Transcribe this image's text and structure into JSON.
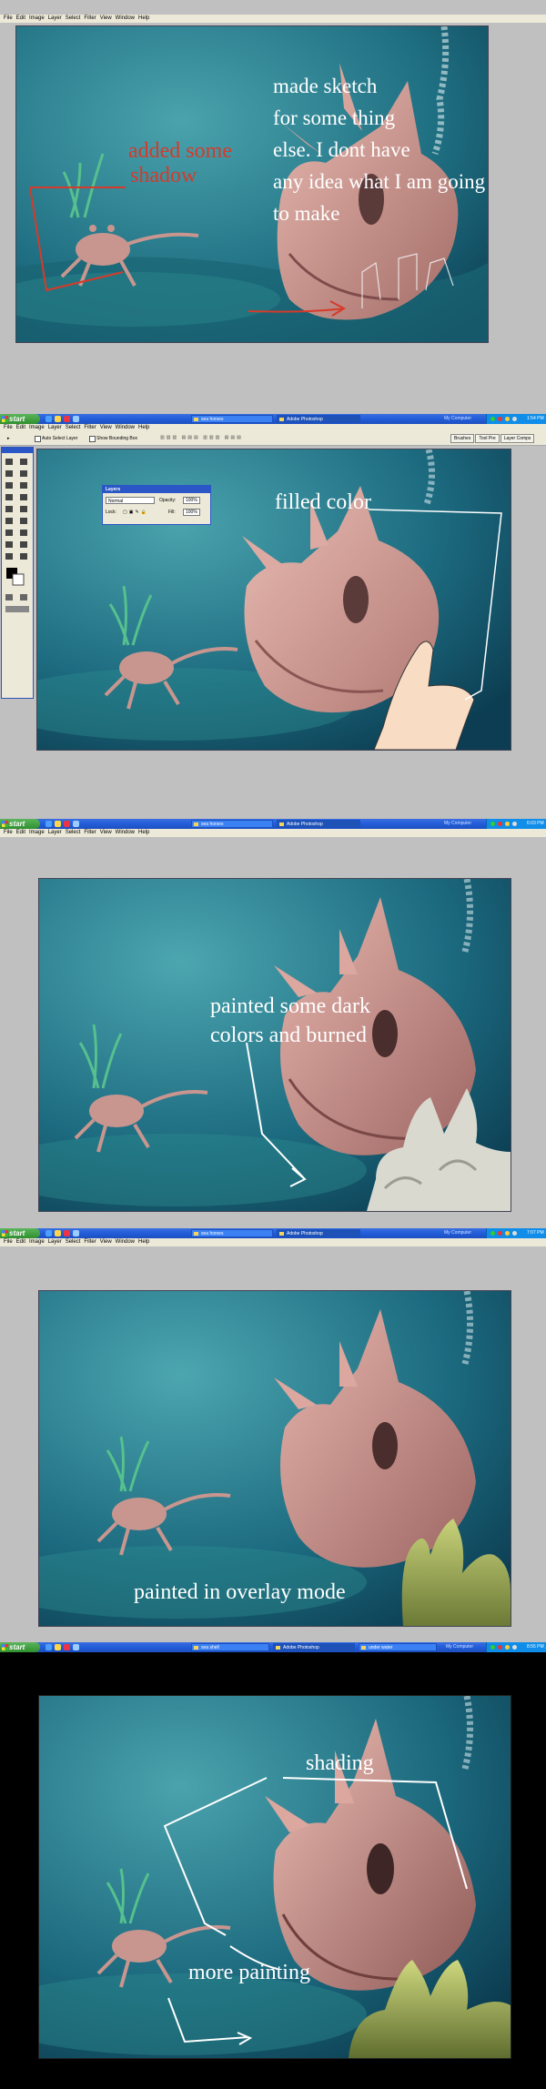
{
  "menu": [
    "File",
    "Edit",
    "Image",
    "Layer",
    "Select",
    "Filter",
    "View",
    "Window",
    "Help"
  ],
  "taskbar": {
    "start": "start",
    "my_computer": "My Computer",
    "b1": {
      "tasks": [
        "sea horses",
        "Adobe Photoshop"
      ],
      "time": "1:54 PM"
    },
    "b2": {
      "tasks": [
        "sea horses",
        "Adobe Photoshop"
      ],
      "time": "6:03 PM"
    },
    "b3": {
      "tasks": [
        "sea horses",
        "Adobe Photoshop"
      ],
      "time": "7:07 PM"
    },
    "b4": {
      "tasks": [
        "sea shell",
        "Adobe Photoshop",
        "under water"
      ],
      "time": "8:55 PM"
    }
  },
  "ps_options": {
    "auto_select": "Auto Select Layer",
    "bounding_box": "Show Bounding Box",
    "palette_tabs": [
      "Brushes",
      "Tool Pre",
      "Layer Comps"
    ]
  },
  "layers_palette": {
    "title": "Layers",
    "blend_mode": "Normal",
    "opacity_label": "Opacity:",
    "opacity_value": "100%",
    "lock_label": "Lock:",
    "fill_label": "Fill:",
    "fill_value": "100%"
  },
  "annotations": {
    "p1_shadow": [
      "added some",
      "shadow"
    ],
    "p1_sketch": [
      "made sketch",
      "for some thing",
      "else.   I dont have",
      "any idea what I am going",
      "to make"
    ],
    "p2_color": "filled color",
    "p3_dark": [
      "painted some dark",
      "colors and burned"
    ],
    "p4_overlay": "painted in overlay mode",
    "p5_shading": "shading",
    "p5_more": "more painting"
  },
  "colors": {
    "water_light": "#3d8fa0",
    "water_dark": "#0c3d52",
    "shell": "#c9968f",
    "annotation_red": "#d63a2a",
    "taskbar_blue": "#245edb"
  }
}
